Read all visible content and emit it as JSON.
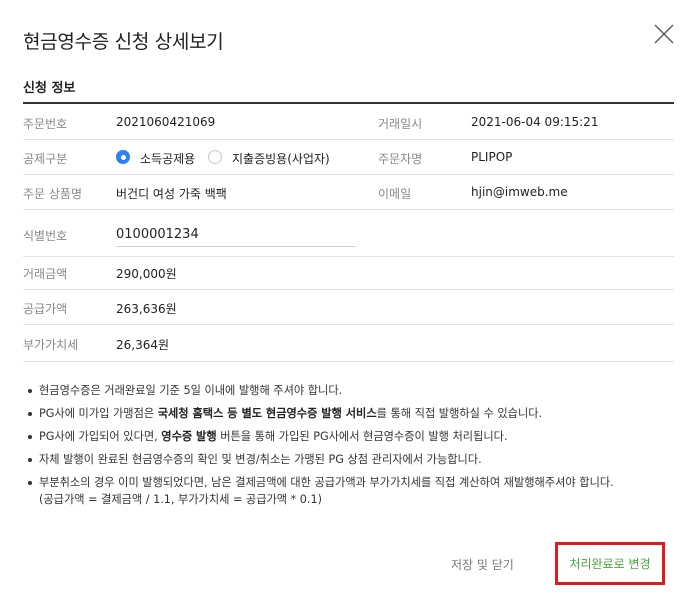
{
  "modal": {
    "title": "현금영수증 신청 상세보기",
    "section_title": "신청 정보"
  },
  "fields": {
    "order_number_label": "주문번호",
    "order_number": "2021060421069",
    "trade_datetime_label": "거래일시",
    "trade_datetime": "2021-06-04 09:15:21",
    "deduction_type_label": "공제구분",
    "deduction_options": [
      "소득공제용",
      "지출증빙용(사업자)"
    ],
    "deduction_selected": "소득공제용",
    "orderer_label": "주문자명",
    "orderer": "PLIPOP",
    "product_label": "주문 상품명",
    "product": "버건디 여성 가죽 백팩",
    "email_label": "이메일",
    "email": "hjin@imweb.me",
    "identifier_label": "식별번호",
    "identifier": "0100001234",
    "trade_amount_label": "거래금액",
    "trade_amount": "290,000원",
    "supply_amount_label": "공급가액",
    "supply_amount": "263,636원",
    "vat_label": "부가가치세",
    "vat": "26,364원"
  },
  "notes": {
    "n1": "현금영수증은 거래완료일 기준 5일 이내에 발행해 주셔야 합니다.",
    "n2_pre": "PG사에 미가입 가맹점은 ",
    "n2_bold": "국세청 홈택스 등 별도 현금영수증 발행 서비스",
    "n2_post": "를 통해 직접 발행하실 수 있습니다.",
    "n3_pre": "PG사에 가입되어 있다면, ",
    "n3_bold": "영수증 발행",
    "n3_post": " 버튼을 통해 가입된 PG사에서 현금영수증이 발행 처리됩니다.",
    "n4": "자체 발행이 완료된 현금영수증의 확인 및 변경/취소는 가맹된 PG 상점 관리자에서 가능합니다.",
    "n5_line1": "부분취소의 경우 이미 발행되었다면, 남은 결제금액에 대한 공급가액과 부가가치세를 직접 계산하여 재발행해주셔야 합니다.",
    "n5_line2": "(공급가액 = 결제금액 / 1.1, 부가가치세 = 공급가액 * 0.1)"
  },
  "buttons": {
    "save_close": "저장 및 닫기",
    "mark_complete": "처리완료로 변경"
  },
  "colors": {
    "accent_blue": "#2f7ff7",
    "complete_text_green": "#46a83d",
    "highlight_red": "#e5191b"
  },
  "icons": {
    "close": "close-icon"
  }
}
